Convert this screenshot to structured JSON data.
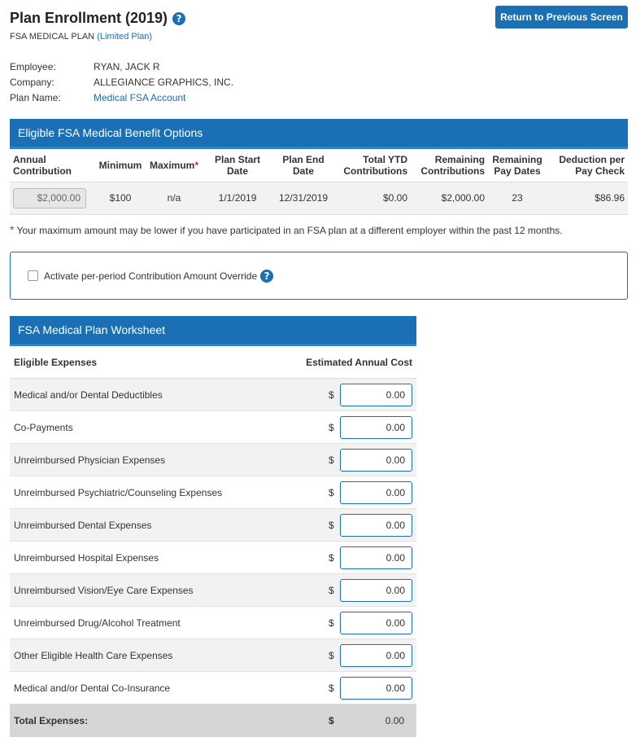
{
  "header": {
    "title": "Plan Enrollment (2019)",
    "plan_name": "FSA MEDICAL PLAN",
    "plan_type": "(Limited Plan)",
    "return_button": "Return to Previous Screen"
  },
  "info": [
    {
      "label": "Employee:",
      "value": "RYAN, JACK R"
    },
    {
      "label": "Company:",
      "value": "ALLEGIANCE GRAPHICS, INC."
    },
    {
      "label": "Plan Name:",
      "value": "Medical FSA Account"
    }
  ],
  "eligible": {
    "title": "Eligible FSA Medical Benefit Options",
    "columns": {
      "annual": "Annual Contribution",
      "minimum": "Minimum",
      "maximum": "Maximum",
      "maximum_star": "*",
      "start": "Plan Start Date",
      "end": "Plan End Date",
      "ytd": "Total YTD Contributions",
      "remaining": "Remaining Contributions",
      "paydates": "Remaining Pay Dates",
      "deduction": "Deduction per Pay Check"
    },
    "row": {
      "annual": "$2,000.00",
      "minimum": "$100",
      "maximum": "n/a",
      "start": "1/1/2019",
      "end": "12/31/2019",
      "ytd": "$0.00",
      "remaining": "$2,000.00",
      "paydates": "23",
      "deduction": "$86.96"
    }
  },
  "footnote": {
    "star": "*",
    "text": "Your maximum amount may be lower if you have participated in an FSA plan at a different employer within the past 12 months."
  },
  "override": {
    "label": "Activate per-period Contribution Amount Override"
  },
  "worksheet": {
    "title": "FSA Medical Plan Worksheet",
    "col_expenses": "Eligible Expenses",
    "col_cost": "Estimated Annual Cost",
    "currency": "$",
    "rows": [
      {
        "label": "Medical and/or Dental Deductibles",
        "value": "0.00"
      },
      {
        "label": "Co-Payments",
        "value": "0.00"
      },
      {
        "label": "Unreimbursed Physician Expenses",
        "value": "0.00"
      },
      {
        "label": "Unreimbursed Psychiatric/Counseling Expenses",
        "value": "0.00"
      },
      {
        "label": "Unreimbursed Dental Expenses",
        "value": "0.00"
      },
      {
        "label": "Unreimbursed Hospital Expenses",
        "value": "0.00"
      },
      {
        "label": "Unreimbursed Vision/Eye Care Expenses",
        "value": "0.00"
      },
      {
        "label": "Unreimbursed Drug/Alcohol Treatment",
        "value": "0.00"
      },
      {
        "label": "Other Eligible Health Care Expenses",
        "value": "0.00"
      },
      {
        "label": "Medical and/or Dental Co-Insurance",
        "value": "0.00"
      }
    ],
    "total_label": "Total Expenses:",
    "total_value": "0.00"
  }
}
